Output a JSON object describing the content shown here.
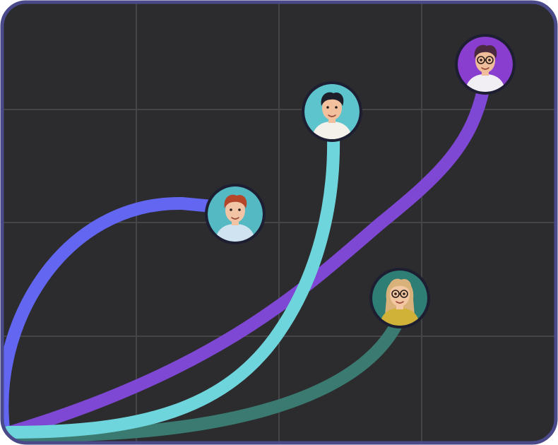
{
  "colors": {
    "background": "#2c2c2e",
    "frame_border": "#4a4a8a",
    "grid_line": "#454547",
    "avatar_ring": "#1e1e32",
    "curve_blue": "#6366f1",
    "curve_purple": "#7e48d4",
    "curve_cyan": "#6fd5dc",
    "curve_teal": "#3a7a70"
  },
  "grid": {
    "visible": true,
    "columns": 4,
    "rows": 4
  },
  "connectors": [
    {
      "name": "blue-curve",
      "color": "#6366f1",
      "target": "avatar-red-hair-woman"
    },
    {
      "name": "purple-curve",
      "color": "#7e48d4",
      "target": "avatar-man-glasses-purple"
    },
    {
      "name": "cyan-curve",
      "color": "#6fd5dc",
      "target": "avatar-man-dark-hair"
    },
    {
      "name": "teal-curve",
      "color": "#3a7a70",
      "target": "avatar-woman-glasses-yellow"
    }
  ],
  "avatars": [
    {
      "name": "avatar-red-hair-woman",
      "bg": "#55b9c4",
      "skin": "#f1c4a6",
      "hair": "#b5462a",
      "shirt": "#cfe3f0",
      "glasses": false,
      "long_hair": false
    },
    {
      "name": "avatar-man-dark-hair",
      "bg": "#5dc4cd",
      "skin": "#f2c09d",
      "hair": "#1e1e2a",
      "shirt": "#f4f1ea",
      "glasses": false,
      "long_hair": false
    },
    {
      "name": "avatar-man-glasses-purple",
      "bg": "#8a3ed0",
      "skin": "#f0bd9a",
      "hair": "#4a2a3e",
      "shirt": "#f1eef4",
      "glasses": true,
      "long_hair": false
    },
    {
      "name": "avatar-woman-glasses-yellow",
      "bg": "#2e7e76",
      "skin": "#f3c7a2",
      "hair": "#d8b27a",
      "shirt": "#d1b238",
      "glasses": true,
      "long_hair": true
    }
  ]
}
